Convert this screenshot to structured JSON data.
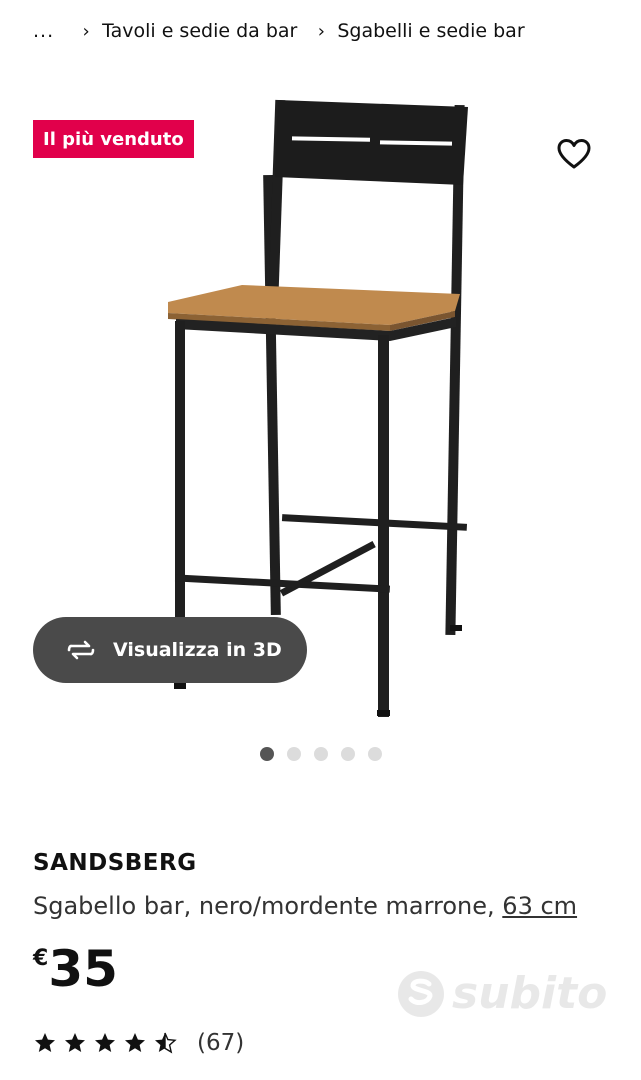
{
  "breadcrumb": {
    "ellipsis": "...",
    "items": [
      {
        "label": "Tavoli e sedie da bar"
      },
      {
        "label": "Sgabelli e sedie bar"
      }
    ]
  },
  "gallery": {
    "badge": "Il più venduto",
    "view_3d_label": "Visualizza in 3D",
    "image_count": 5,
    "active_index": 0
  },
  "product": {
    "name": "SANDSBERG",
    "description": "Sgabello bar, nero/mordente marrone, ",
    "size": "63 cm",
    "currency": "€",
    "price": "35",
    "rating_value": 4.5,
    "review_count": "(67)"
  },
  "watermark": {
    "text": "subito"
  },
  "colors": {
    "badge": "#e1004b",
    "view3d_button": "#4a4a4a",
    "seat_wood": "#c08a4e",
    "frame": "#1f1f1f"
  },
  "icons": [
    "chevron-right-icon",
    "heart-icon",
    "rotate-3d-icon",
    "star-icon",
    "half-star-icon"
  ]
}
